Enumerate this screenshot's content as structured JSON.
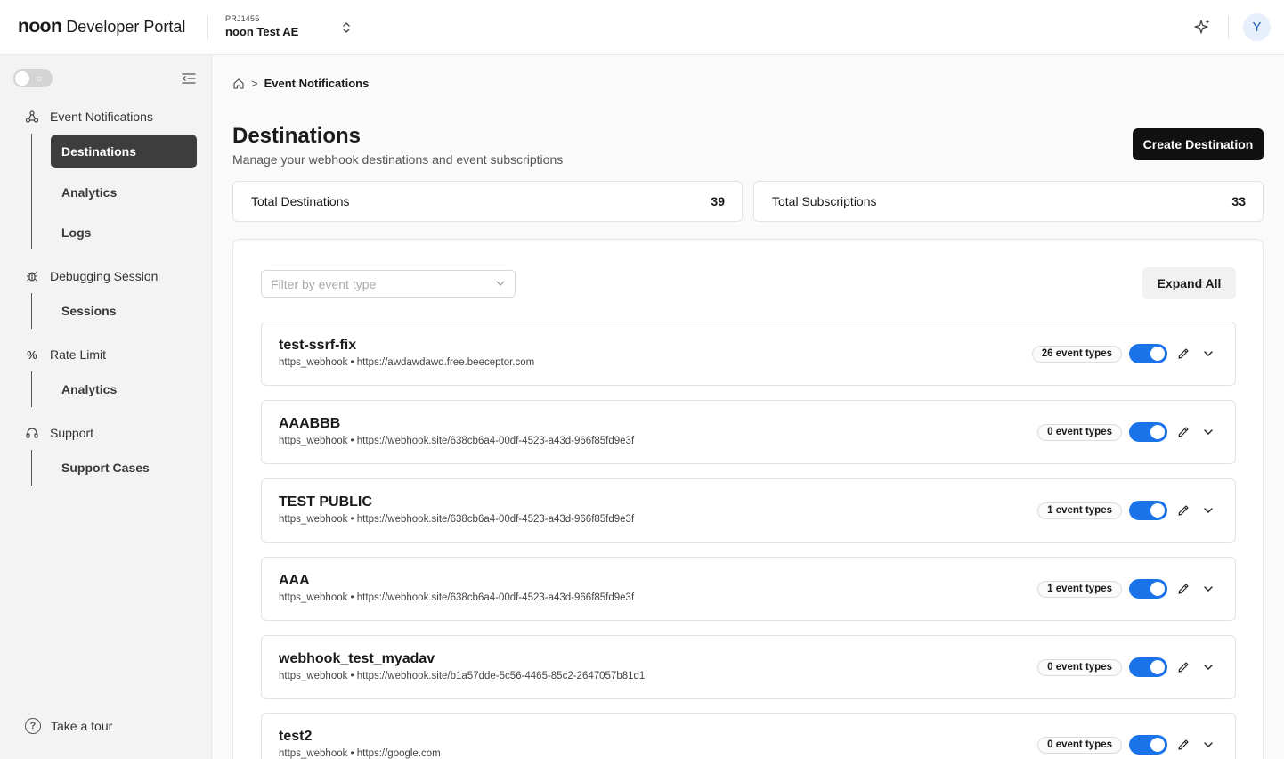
{
  "header": {
    "brand": "noon",
    "portal": "Developer Portal",
    "project_code": "PRJ1455",
    "project_name": "noon Test AE",
    "avatar_initial": "Y"
  },
  "sidebar": {
    "sections": [
      {
        "label": "Event Notifications",
        "icon": "webhook-icon",
        "items": [
          {
            "label": "Destinations",
            "active": true
          },
          {
            "label": "Analytics"
          },
          {
            "label": "Logs"
          }
        ]
      },
      {
        "label": "Debugging Session",
        "icon": "bug-icon",
        "items": [
          {
            "label": "Sessions"
          }
        ]
      },
      {
        "label": "Rate Limit",
        "icon": "percent-icon",
        "items": [
          {
            "label": "Analytics"
          }
        ]
      },
      {
        "label": "Support",
        "icon": "headset-icon",
        "items": [
          {
            "label": "Support Cases"
          }
        ]
      }
    ],
    "tour_label": "Take a tour"
  },
  "breadcrumb": {
    "separator": ">",
    "current": "Event Notifications"
  },
  "page": {
    "title": "Destinations",
    "subtitle": "Manage your webhook destinations and event subscriptions",
    "create_label": "Create Destination"
  },
  "stats": [
    {
      "label": "Total Destinations",
      "value": "39"
    },
    {
      "label": "Total Subscriptions",
      "value": "33"
    }
  ],
  "filter": {
    "placeholder": "Filter by event type"
  },
  "expand_label": "Expand All",
  "destinations": [
    {
      "name": "test-ssrf-fix",
      "meta": "https_webhook • https://awdawdawd.free.beeceptor.com",
      "events": "26 event types",
      "enabled": true
    },
    {
      "name": "AAABBB",
      "meta": "https_webhook • https://webhook.site/638cb6a4-00df-4523-a43d-966f85fd9e3f",
      "events": "0 event types",
      "enabled": true
    },
    {
      "name": "TEST PUBLIC",
      "meta": "https_webhook • https://webhook.site/638cb6a4-00df-4523-a43d-966f85fd9e3f",
      "events": "1 event types",
      "enabled": true
    },
    {
      "name": "AAA",
      "meta": "https_webhook • https://webhook.site/638cb6a4-00df-4523-a43d-966f85fd9e3f",
      "events": "1 event types",
      "enabled": true
    },
    {
      "name": "webhook_test_myadav",
      "meta": "https_webhook • https://webhook.site/b1a57dde-5c56-4465-85c2-2647057b81d1",
      "events": "0 event types",
      "enabled": true
    },
    {
      "name": "test2",
      "meta": "https_webhook • https://google.com",
      "events": "0 event types",
      "enabled": true
    }
  ],
  "colors": {
    "accent": "#1a73e8",
    "active_nav": "#3d3d3d",
    "primary_button": "#111111"
  }
}
